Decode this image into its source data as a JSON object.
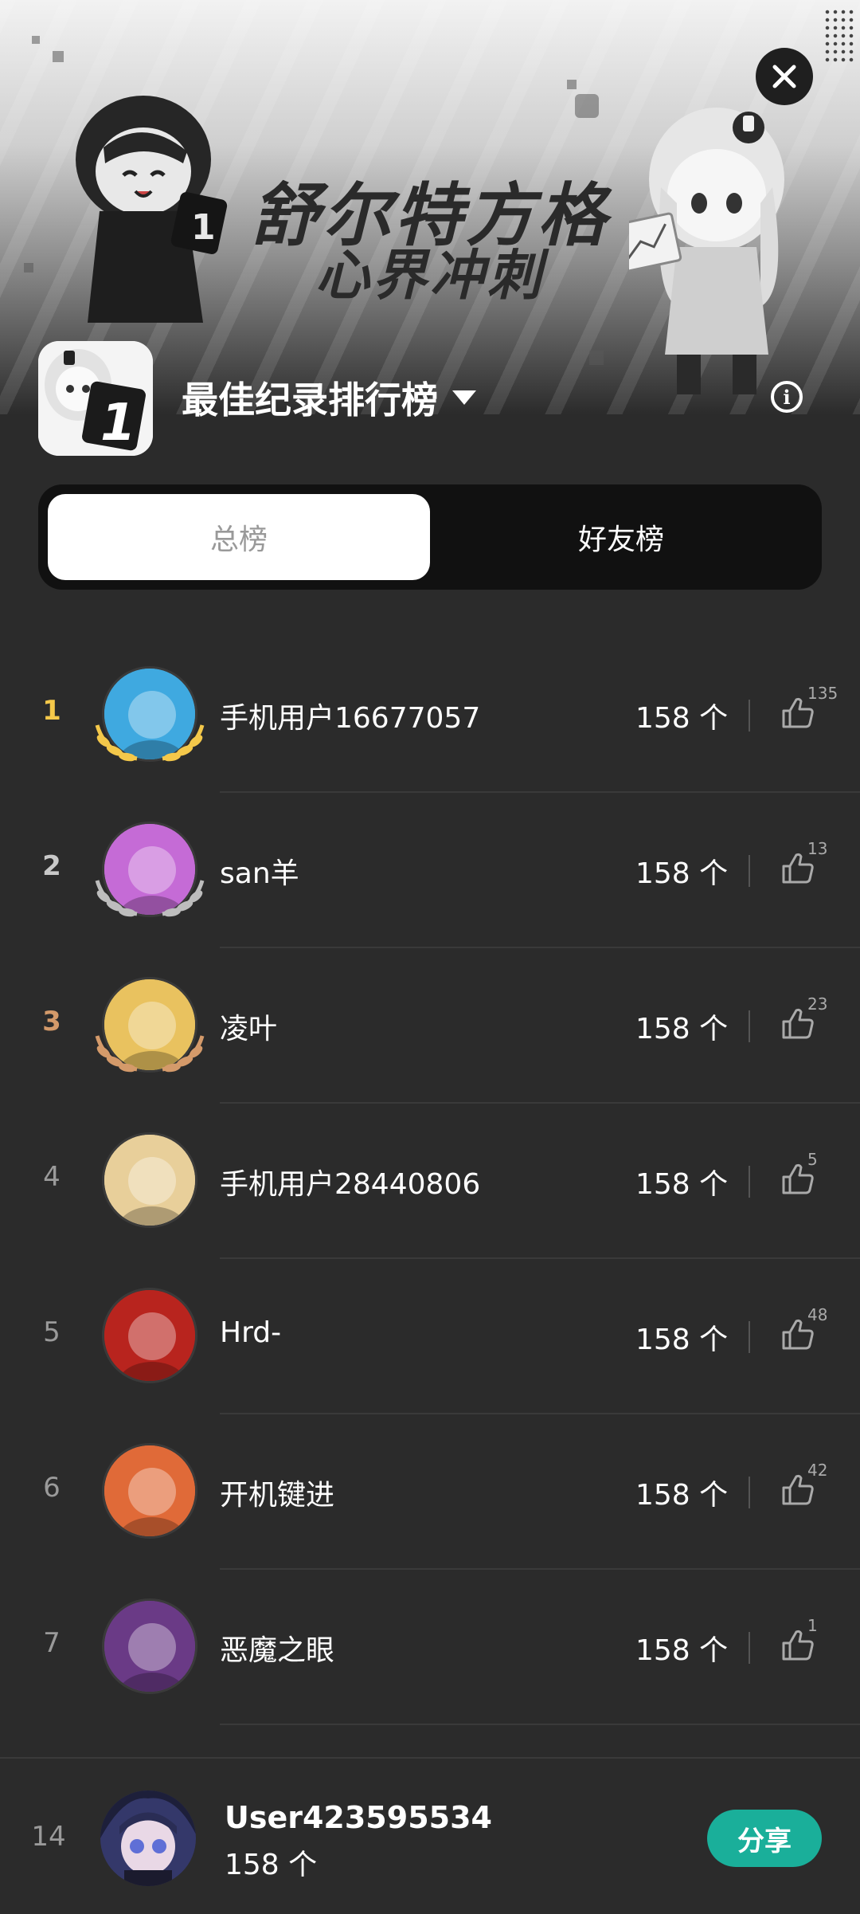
{
  "banner": {
    "title_line1": "舒尔特方格",
    "title_line2": "心界冲刺"
  },
  "header": {
    "app_icon_digit": "1",
    "title": "最佳纪录排行榜",
    "info_glyph": "i"
  },
  "tabs": [
    {
      "label": "总榜",
      "active": true
    },
    {
      "label": "好友榜",
      "active": false
    }
  ],
  "leaderboard": [
    {
      "rank": "1",
      "name": "手机用户16677057",
      "score": "158 个",
      "likes": "135",
      "medal": "gold",
      "avatar_color": "#3fa9e0"
    },
    {
      "rank": "2",
      "name": "san羊",
      "score": "158 个",
      "likes": "13",
      "medal": "silver",
      "avatar_color": "#c56bd6"
    },
    {
      "rank": "3",
      "name": "凌叶",
      "score": "158 个",
      "likes": "23",
      "medal": "bronze",
      "avatar_color": "#e9c25f"
    },
    {
      "rank": "4",
      "name": "手机用户28440806",
      "score": "158 个",
      "likes": "5",
      "medal": "",
      "avatar_color": "#e8cf9a"
    },
    {
      "rank": "5",
      "name": "Hrd-",
      "score": "158 个",
      "likes": "48",
      "medal": "",
      "avatar_color": "#b8241e"
    },
    {
      "rank": "6",
      "name": "开机键进",
      "score": "158 个",
      "likes": "42",
      "medal": "",
      "avatar_color": "#e06a38"
    },
    {
      "rank": "7",
      "name": "恶魔之眼",
      "score": "158 个",
      "likes": "1",
      "medal": "",
      "avatar_color": "#6a3a86"
    }
  ],
  "me": {
    "rank": "14",
    "name": "User423595534",
    "score": "158 个",
    "avatar_color": "#34386a"
  },
  "share_label": "分享",
  "colors": {
    "accent": "#1aaf9a",
    "gold": "#f4c84a",
    "silver": "#c8c8c8",
    "bronze": "#d49a6a"
  }
}
